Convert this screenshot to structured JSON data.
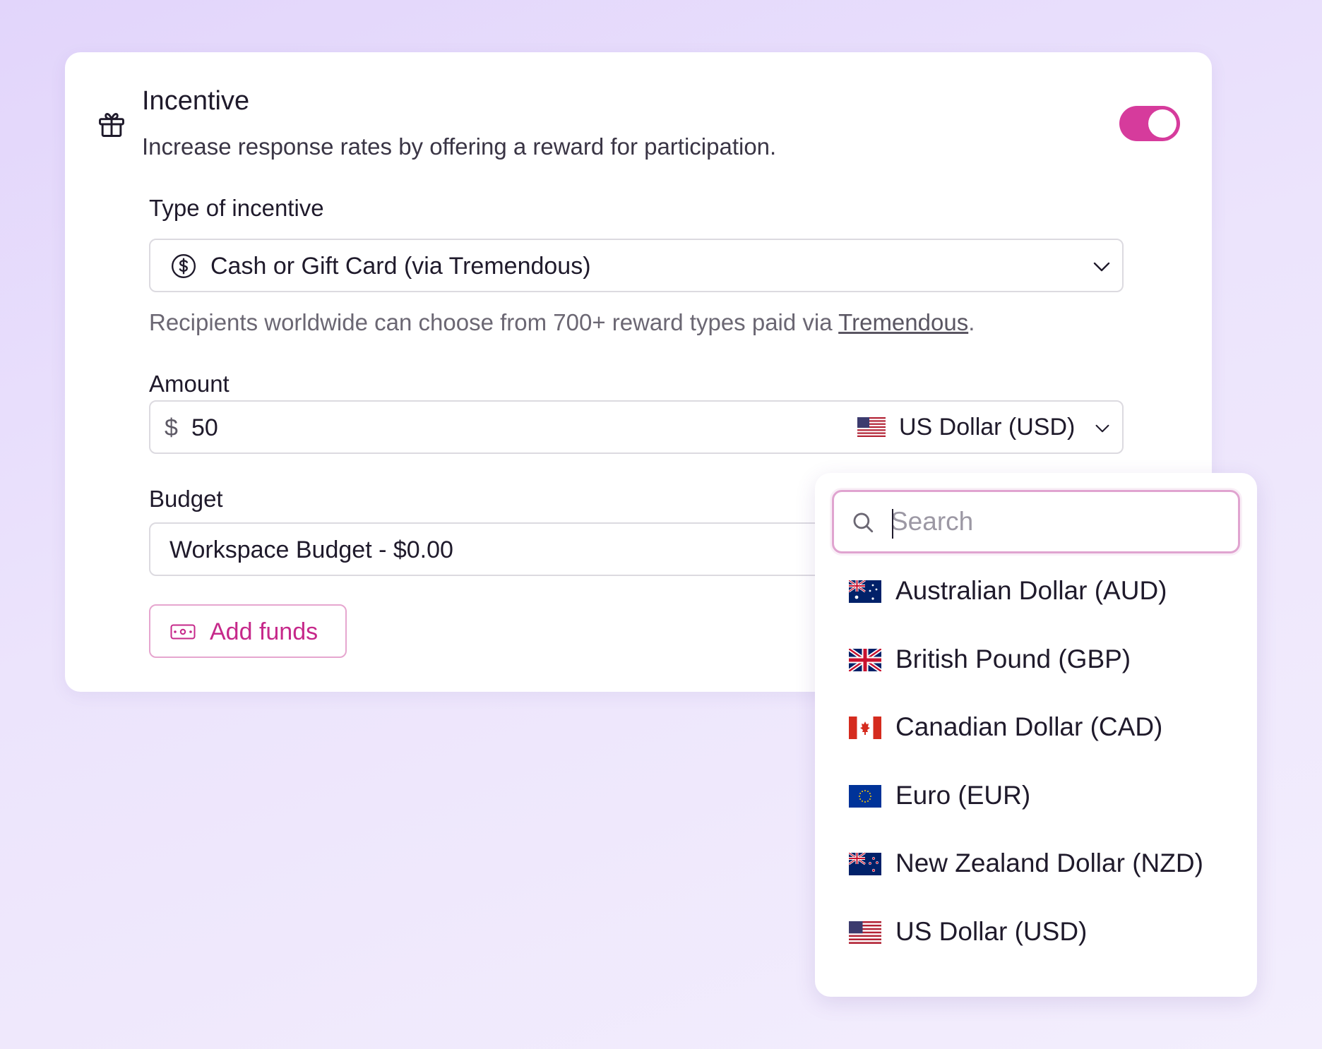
{
  "incentive": {
    "title": "Incentive",
    "description": "Increase response rates by offering a reward for participation.",
    "toggle_on": true,
    "accent_color": "#d63b9c"
  },
  "type_of_incentive": {
    "label": "Type of incentive",
    "selected": "Cash or Gift Card (via Tremendous)",
    "helper_prefix": "Recipients worldwide can choose from 700+ reward types paid via ",
    "helper_link": "Tremendous",
    "helper_suffix": "."
  },
  "amount": {
    "label": "Amount",
    "currency_symbol": "$",
    "value": "50",
    "currency": "US Dollar (USD)"
  },
  "budget": {
    "label": "Budget",
    "selected": "Workspace Budget - $0.00"
  },
  "add_funds": {
    "label": "Add funds"
  },
  "currency_dropdown": {
    "search_placeholder": "Search",
    "options": [
      {
        "label": "Australian Dollar (AUD)",
        "flag": "australia-flag-icon"
      },
      {
        "label": "British Pound (GBP)",
        "flag": "united-kingdom-flag-icon"
      },
      {
        "label": "Canadian Dollar (CAD)",
        "flag": "canada-flag-icon"
      },
      {
        "label": "Euro (EUR)",
        "flag": "european-union-flag-icon"
      },
      {
        "label": "New Zealand Dollar (NZD)",
        "flag": "new-zealand-flag-icon"
      },
      {
        "label": "US Dollar (USD)",
        "flag": "united-states-flag-icon"
      }
    ]
  }
}
